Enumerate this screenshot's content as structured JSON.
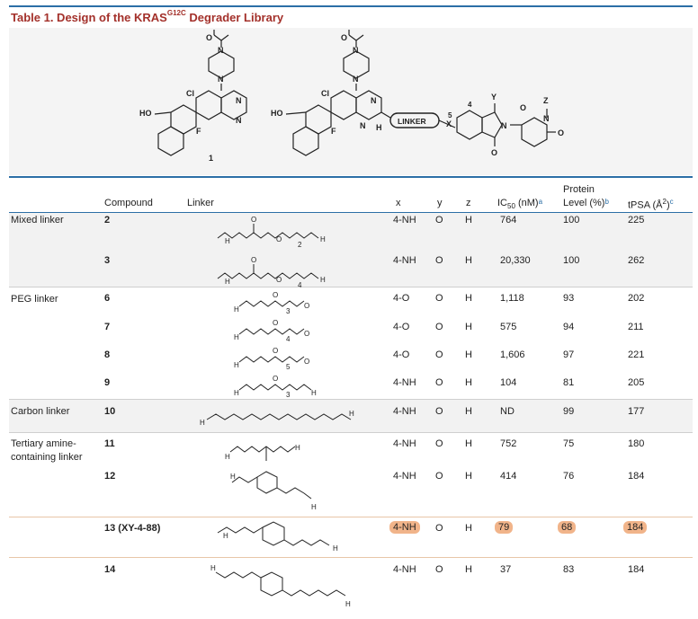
{
  "title": {
    "prefix": "Table 1. Design of the KRAS",
    "sup": "G12C",
    "suffix": " Degrader Library"
  },
  "scheme": {
    "compound1_label": "1",
    "linker_box": "LINKER",
    "atoms": {
      "O": "O",
      "N": "N",
      "Cl": "Cl",
      "F": "F",
      "HO": "HO",
      "H": "H",
      "X": "X",
      "Y": "Y",
      "Z": "Z",
      "pos4": "4",
      "pos5": "5"
    }
  },
  "headers": {
    "compound": "Compound",
    "linker": "Linker",
    "x": "x",
    "y": "y",
    "z": "z",
    "ic50": "IC",
    "ic50_sub": "50",
    "ic50_unit": " (nM)",
    "ic50_note": "a",
    "protein_line1": "Protein",
    "protein_line2": "Level (%)",
    "protein_note": "b",
    "tpsa": "tPSA (Å",
    "tpsa_sup": "2",
    "tpsa_close": ")",
    "tpsa_note": "c"
  },
  "groups": [
    {
      "name": "Mixed linker"
    },
    {
      "name": "PEG linker"
    },
    {
      "name": "Carbon linker"
    },
    {
      "name": "Tertiary amine-containing linker"
    }
  ],
  "rows": [
    {
      "compound": "2",
      "x": "4-NH",
      "y": "O",
      "z": "H",
      "ic50": "764",
      "protein": "100",
      "tpsa": "225",
      "linker_sub": "2"
    },
    {
      "compound": "3",
      "x": "4-NH",
      "y": "O",
      "z": "H",
      "ic50": "20,330",
      "protein": "100",
      "tpsa": "262",
      "linker_sub": "4"
    },
    {
      "compound": "6",
      "x": "4-O",
      "y": "O",
      "z": "H",
      "ic50": "1,118",
      "protein": "93",
      "tpsa": "202",
      "linker_sub": "3"
    },
    {
      "compound": "7",
      "x": "4-O",
      "y": "O",
      "z": "H",
      "ic50": "575",
      "protein": "94",
      "tpsa": "211",
      "linker_sub": "4"
    },
    {
      "compound": "8",
      "x": "4-O",
      "y": "O",
      "z": "H",
      "ic50": "1,606",
      "protein": "97",
      "tpsa": "221",
      "linker_sub": "5"
    },
    {
      "compound": "9",
      "x": "4-NH",
      "y": "O",
      "z": "H",
      "ic50": "104",
      "protein": "81",
      "tpsa": "205",
      "linker_sub": "3"
    },
    {
      "compound": "10",
      "x": "4-NH",
      "y": "O",
      "z": "H",
      "ic50": "ND",
      "protein": "99",
      "tpsa": "177"
    },
    {
      "compound": "11",
      "x": "4-NH",
      "y": "O",
      "z": "H",
      "ic50": "752",
      "protein": "75",
      "tpsa": "180"
    },
    {
      "compound": "12",
      "x": "4-NH",
      "y": "O",
      "z": "H",
      "ic50": "414",
      "protein": "76",
      "tpsa": "184"
    },
    {
      "compound": "13 (XY-4-88)",
      "x": "4-NH",
      "y": "O",
      "z": "H",
      "ic50": "79",
      "protein": "68",
      "tpsa": "184",
      "highlight": true
    },
    {
      "compound": "14",
      "x": "4-NH",
      "y": "O",
      "z": "H",
      "ic50": "37",
      "protein": "83",
      "tpsa": "184"
    }
  ],
  "colors": {
    "rule": "#2c6fa6",
    "title": "#a3302a",
    "highlight": "#f1b48a",
    "band": "#f2f2f2"
  }
}
